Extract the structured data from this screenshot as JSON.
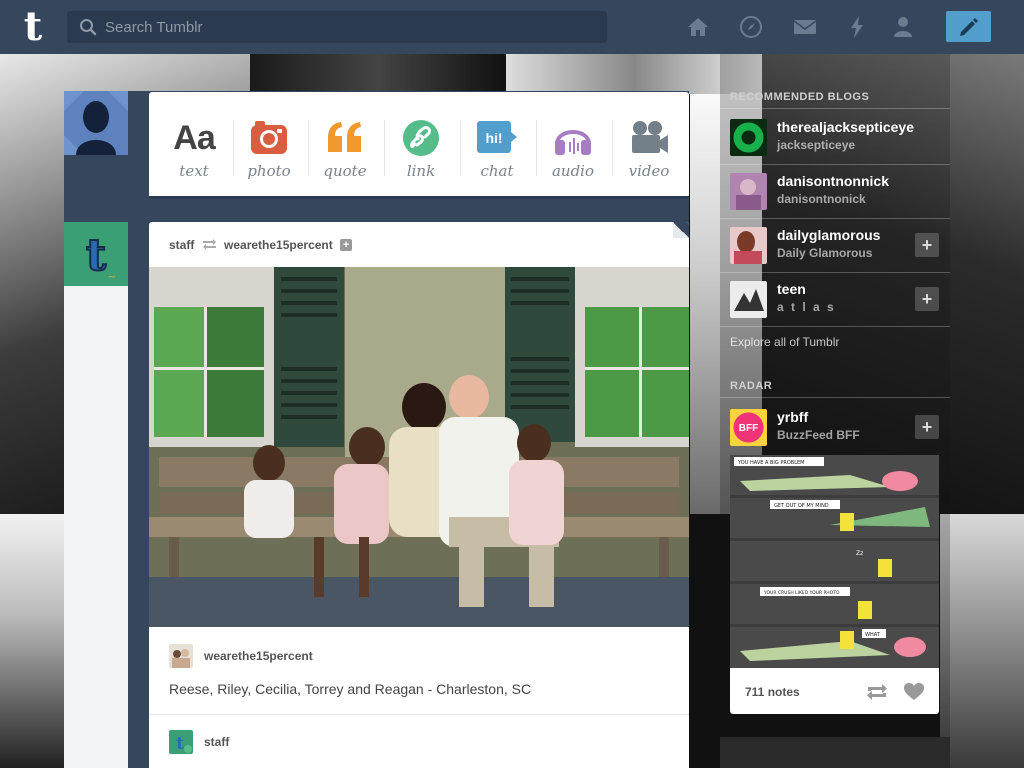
{
  "header": {
    "logo_letter": "t",
    "search_placeholder": "Search Tumblr",
    "nav_icons": [
      "home-icon",
      "explore-icon",
      "inbox-icon",
      "activity-icon",
      "account-icon"
    ],
    "compose_icon": "pencil-icon"
  },
  "post_types": [
    {
      "label": "text",
      "icon": "text-icon",
      "glyph": "Aa",
      "color": "#444444"
    },
    {
      "label": "photo",
      "icon": "camera-icon",
      "glyph": "",
      "color": "#d95e40"
    },
    {
      "label": "quote",
      "icon": "quote-icon",
      "glyph": "““",
      "color": "#f2992e"
    },
    {
      "label": "link",
      "icon": "link-icon",
      "glyph": "",
      "color": "#56bc8a"
    },
    {
      "label": "chat",
      "icon": "chat-icon",
      "glyph": "hi!",
      "color": "#529ecc"
    },
    {
      "label": "audio",
      "icon": "headphones-icon",
      "glyph": "",
      "color": "#a77dc2"
    },
    {
      "label": "video",
      "icon": "video-camera-icon",
      "glyph": "",
      "color": "#748089"
    }
  ],
  "post": {
    "reblogger": "staff",
    "source": "wearethe15percent",
    "attribution_name": "wearethe15percent",
    "caption": "Reese, Riley, Cecilia, Torrey and Reagan - Charleston, SC",
    "second_attribution": "staff"
  },
  "sidebar": {
    "recommended_title": "RECOMMENDED BLOGS",
    "blogs": [
      {
        "name": "therealjacksepticeye",
        "sub": "jacksepticeye",
        "avatar_color": "#18b04a"
      },
      {
        "name": "danisontnonnick",
        "sub": "danisontnonick",
        "avatar_color": "#b084b0"
      },
      {
        "name": "dailyglamorous",
        "sub": "Daily Glamorous",
        "avatar_color": "#c24a5a"
      },
      {
        "name": "teen",
        "sub": "a t l a s",
        "avatar_color": "#dddddd"
      }
    ],
    "explore_link": "Explore all of Tumblr",
    "radar_title": "RADAR",
    "radar": {
      "name": "yrbff",
      "sub": "BuzzFeed BFF",
      "avatar_text": "BFF",
      "avatar_color": "#ee3377",
      "notes": "711 notes",
      "comic_captions": [
        "YOU HAVE A BIG PROBLEM",
        "GET OUT OF MY MIND",
        "Zz",
        "YOUR CRUSH LIKED YOUR PHOTO",
        "WHAT"
      ]
    }
  }
}
